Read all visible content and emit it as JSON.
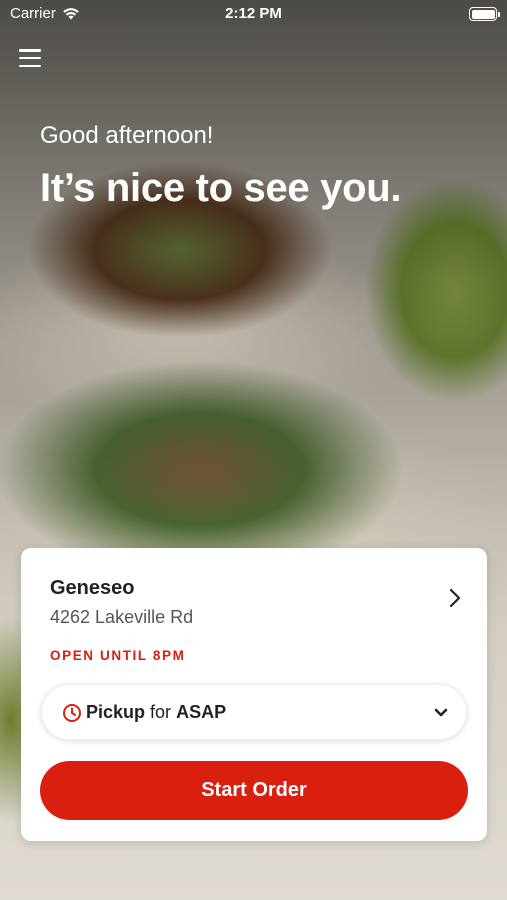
{
  "status_bar": {
    "carrier": "Carrier",
    "time": "2:12 PM",
    "battery_level": 1.0
  },
  "hero": {
    "greeting": "Good afternoon!",
    "headline": "It’s nice to see you."
  },
  "location": {
    "name": "Geneseo",
    "address": "4262 Lakeville Rd",
    "status": "OPEN UNTIL 8PM"
  },
  "order_mode": {
    "mode": "Pickup",
    "for": "for",
    "time": "ASAP"
  },
  "cta": {
    "label": "Start Order"
  },
  "colors": {
    "accent": "#d9200f",
    "card_bg": "#ffffff",
    "text_primary": "#222222"
  },
  "icons": [
    "wifi-icon",
    "battery-icon",
    "menu-icon",
    "chevron-right-icon",
    "clock-icon",
    "chevron-down-icon"
  ]
}
